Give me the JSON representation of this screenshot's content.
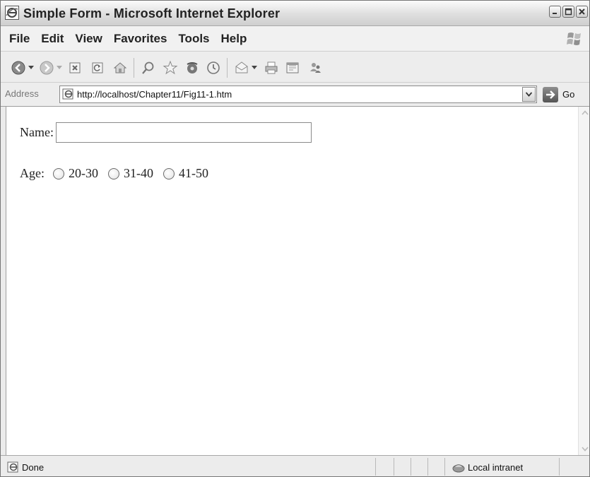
{
  "window": {
    "title": "Simple Form - Microsoft Internet Explorer"
  },
  "menu": [
    "File",
    "Edit",
    "View",
    "Favorites",
    "Tools",
    "Help"
  ],
  "toolbar_icons": [
    "back-icon",
    "forward-icon",
    "stop-icon",
    "refresh-icon",
    "home-icon",
    "search-icon",
    "favorites-icon",
    "media-icon",
    "history-icon",
    "mail-icon",
    "print-icon",
    "edit-icon",
    "messenger-icon"
  ],
  "address": {
    "label": "Address",
    "url": "http://localhost/Chapter11/Fig11-1.htm",
    "go_label": "Go"
  },
  "form": {
    "name_label": "Name:",
    "name_value": "",
    "age_label": "Age:",
    "age_options": [
      "20-30",
      "31-40",
      "41-50"
    ]
  },
  "status": {
    "text": "Done",
    "zone": "Local intranet"
  }
}
